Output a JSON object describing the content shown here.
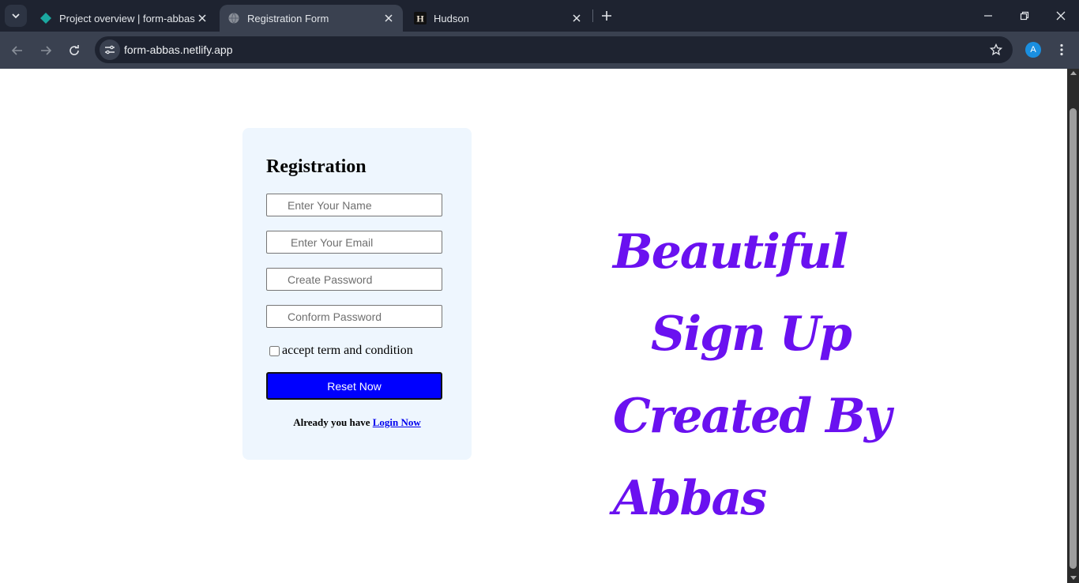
{
  "browser": {
    "tabs": [
      {
        "title": "Project overview | form-abbas |",
        "active": false,
        "icon": "netlify-diamond-icon"
      },
      {
        "title": "Registration Form",
        "active": true,
        "icon": "globe-icon"
      },
      {
        "title": "Hudson",
        "active": false,
        "icon": "hudson-h-icon"
      }
    ],
    "url": "form-abbas.netlify.app",
    "profile_initial": "A"
  },
  "form": {
    "heading": "Registration",
    "name_placeholder": "Enter Your Name",
    "email_placeholder": "Enter Your Email",
    "password_placeholder": "Create Password",
    "confirm_placeholder": "Conform Password",
    "terms_label": "accept term and condition",
    "terms_checked": false,
    "submit_label": "Reset Now",
    "already_text": "Already you have",
    "login_link": "Login Now"
  },
  "hero": {
    "line1": "Beautiful",
    "line2": "Sign Up",
    "line3": "Created By",
    "line4": "Abbas"
  },
  "colors": {
    "accent_purple": "#6a11f0",
    "button_blue": "#0000ff",
    "card_background": "#eef6fe"
  }
}
